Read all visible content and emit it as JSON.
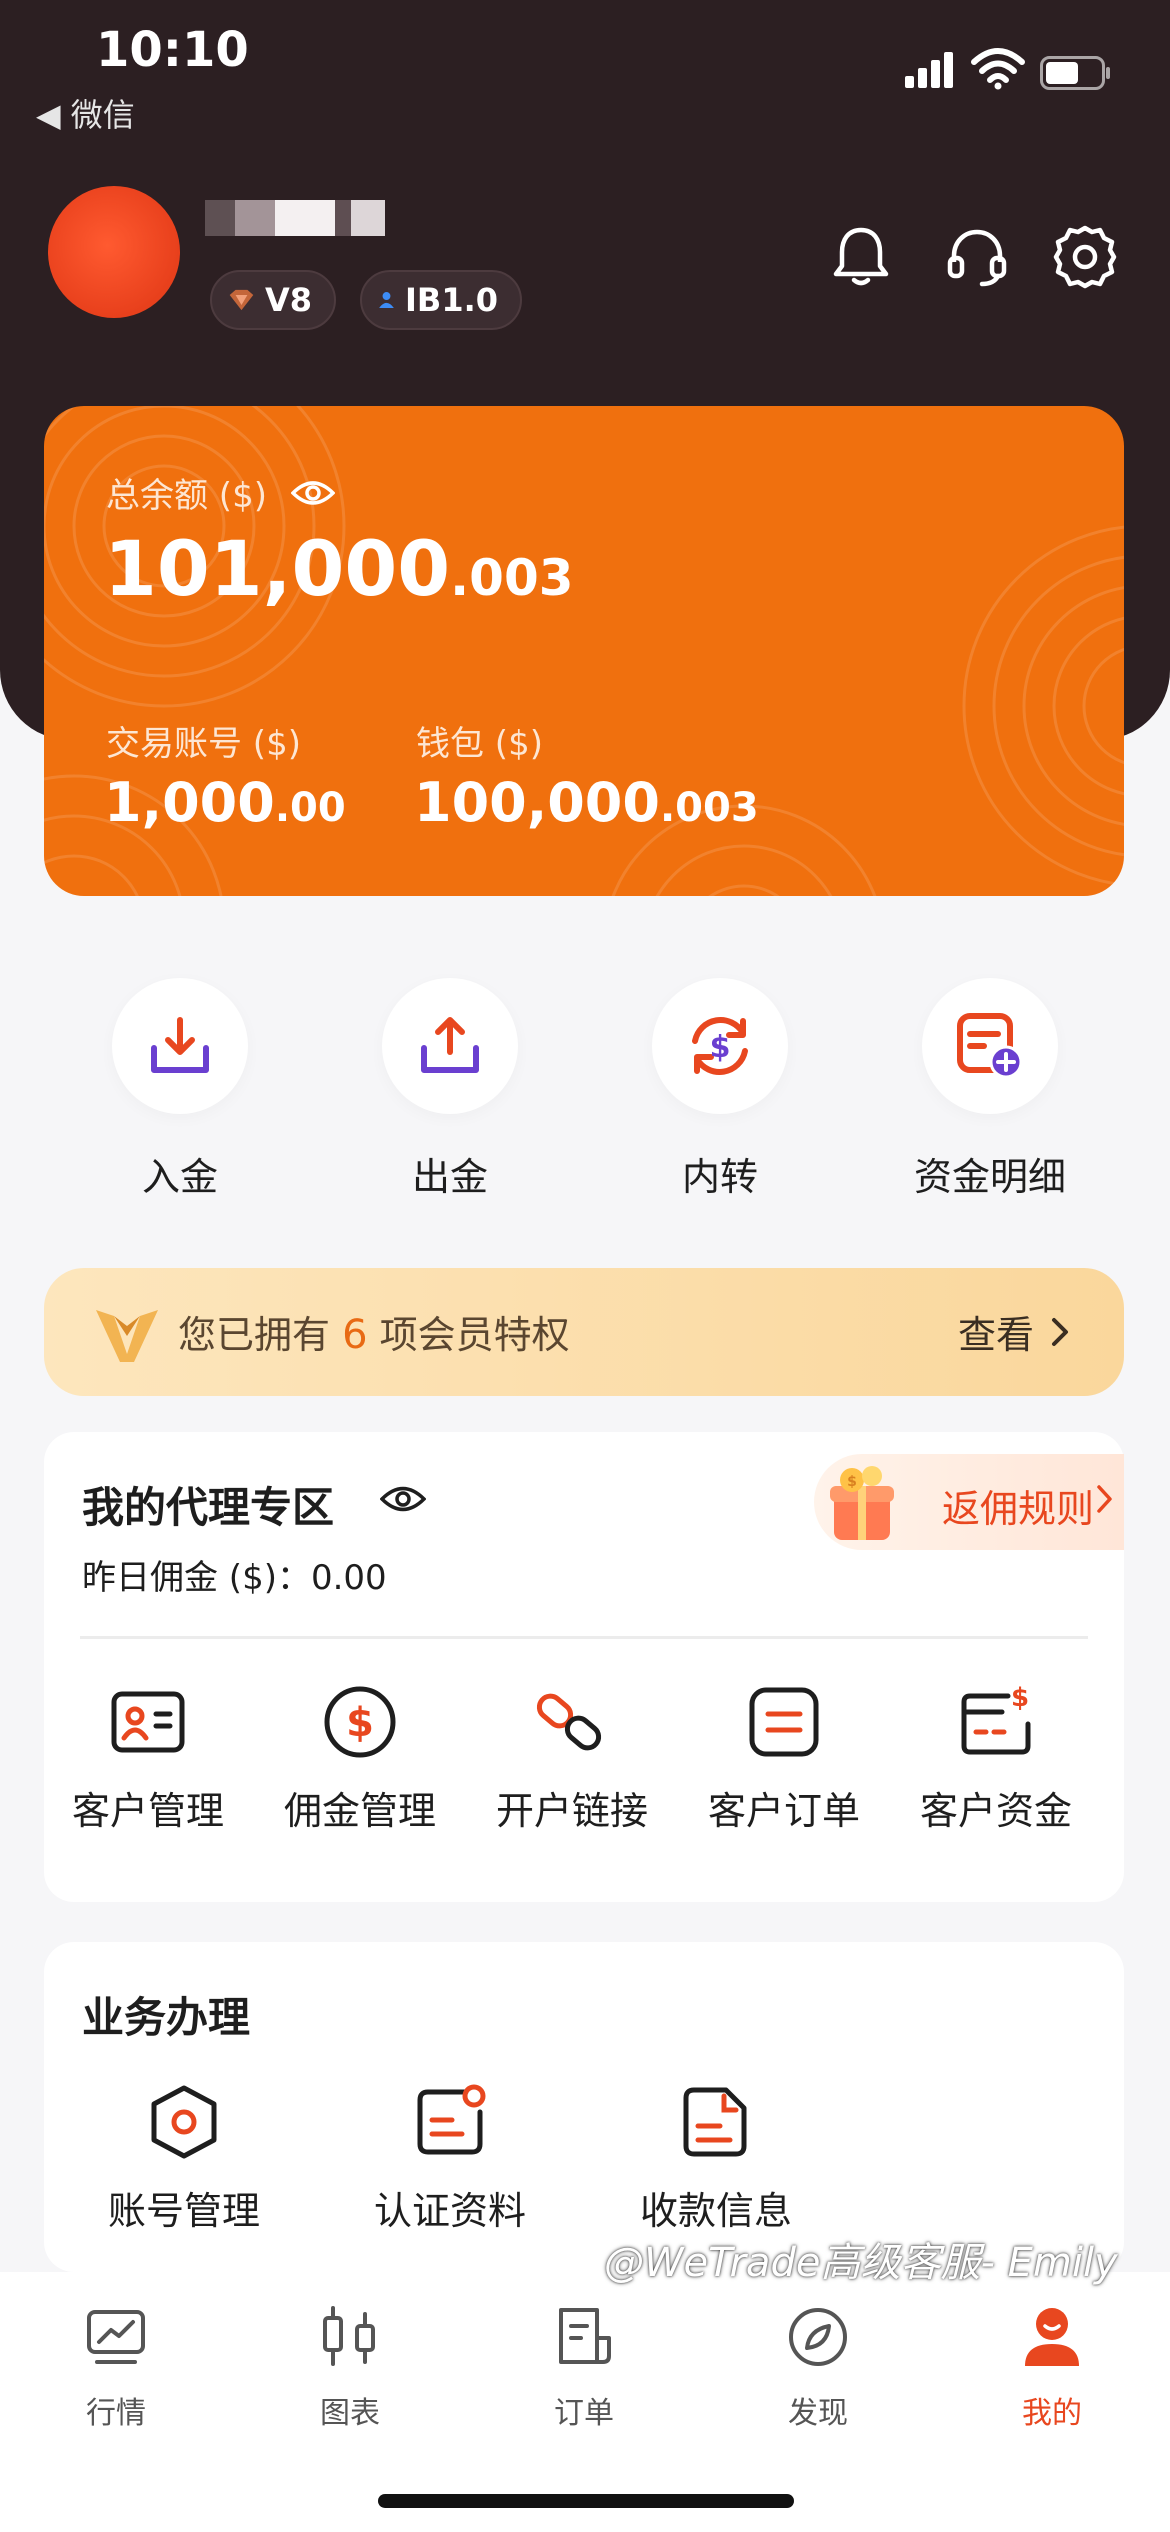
{
  "status_bar": {
    "time": "10:10",
    "back_label": "◀ 微信"
  },
  "profile": {
    "badges": [
      {
        "label": "V8"
      },
      {
        "label": "IB1.0"
      }
    ],
    "icons": [
      "bell-icon",
      "headset-icon",
      "gear-icon"
    ]
  },
  "balance": {
    "total_label": "总余额 ($)",
    "total_main": "101,000",
    "total_decimal": ".003",
    "trading_label": "交易账号 ($)",
    "trading_main": "1,000",
    "trading_decimal": ".00",
    "wallet_label": "钱包 ($)",
    "wallet_main": "100,000",
    "wallet_decimal": ".003"
  },
  "quick_actions": [
    {
      "label": "入金",
      "icon": "deposit-icon"
    },
    {
      "label": "出金",
      "icon": "withdraw-icon"
    },
    {
      "label": "内转",
      "icon": "transfer-icon"
    },
    {
      "label": "资金明细",
      "icon": "fund-details-icon"
    }
  ],
  "vip_banner": {
    "prefix": "您已拥有 ",
    "count": "6",
    "suffix": " 项会员特权",
    "view_label": "查看"
  },
  "agent": {
    "title": "我的代理专区",
    "rebate_label": "返佣规则",
    "commission_text": "昨日佣金 ($)：0.00",
    "items": [
      {
        "label": "客户管理",
        "icon": "client-management-icon"
      },
      {
        "label": "佣金管理",
        "icon": "commission-management-icon"
      },
      {
        "label": "开户链接",
        "icon": "account-link-icon"
      },
      {
        "label": "客户订单",
        "icon": "client-orders-icon"
      },
      {
        "label": "客户资金",
        "icon": "client-funds-icon"
      }
    ]
  },
  "business": {
    "title": "业务办理",
    "items": [
      {
        "label": "账号管理",
        "icon": "account-management-icon"
      },
      {
        "label": "认证资料",
        "icon": "verification-docs-icon"
      },
      {
        "label": "收款信息",
        "icon": "payment-info-icon"
      }
    ]
  },
  "tabbar": [
    {
      "label": "行情",
      "icon": "market-icon"
    },
    {
      "label": "图表",
      "icon": "chart-icon"
    },
    {
      "label": "订单",
      "icon": "orders-icon"
    },
    {
      "label": "发现",
      "icon": "discover-icon"
    },
    {
      "label": "我的",
      "icon": "profile-icon",
      "active": true
    }
  ],
  "watermark": "@WeTrade高级客服- Emily",
  "colors": {
    "accent": "#f0700e",
    "brand_red": "#e8471f",
    "icon_purple": "#6a3fd0",
    "header_dark": "#2c1f22"
  }
}
